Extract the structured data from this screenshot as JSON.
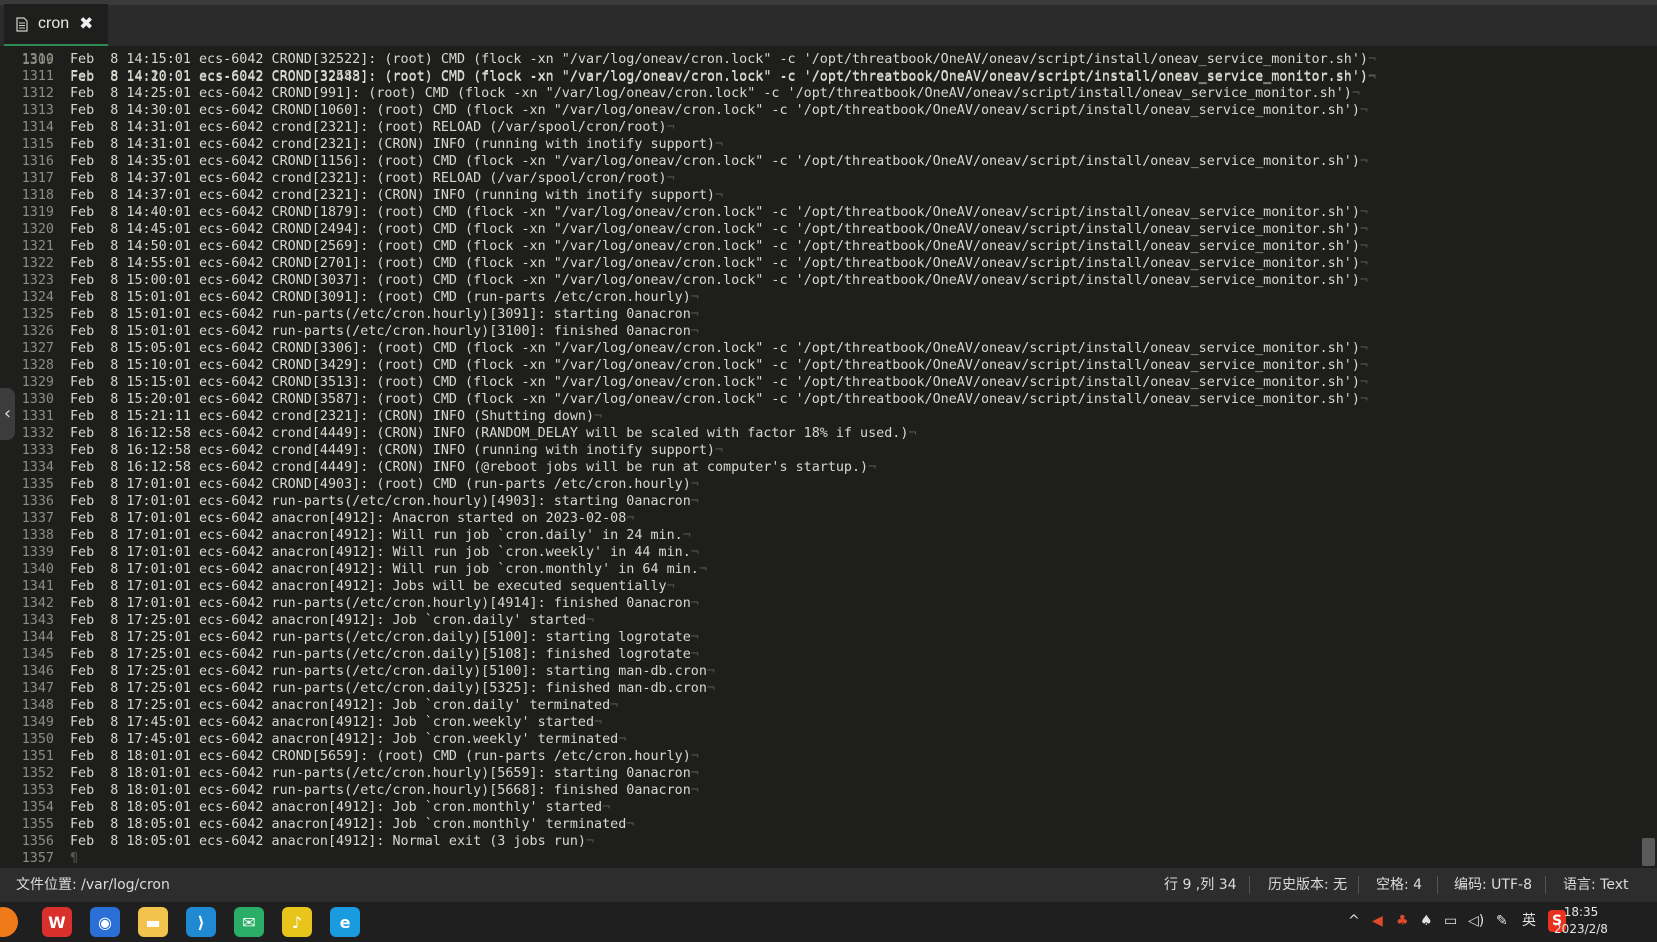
{
  "tab": {
    "name": "cron",
    "close_glyph": "✖"
  },
  "editor": {
    "partial_top_line": {
      "num": "1309",
      "text": "Feb  8 14:10:01 ecs-6042 CROND[32448]: (root) CMD (flock -xn \"/var/log/oneav/cron.lock\" -c '/opt/threatbook/OneAV/oneav/script/install/oneav_service_monitor.sh')"
    },
    "lines": [
      {
        "num": "1310",
        "text": "Feb  8 14:15:01 ecs-6042 CROND[32522]: (root) CMD (flock -xn \"/var/log/oneav/cron.lock\" -c '/opt/threatbook/OneAV/oneav/script/install/oneav_service_monitor.sh')"
      },
      {
        "num": "1311",
        "text": "Feb  8 14:20:01 ecs-6042 CROND[32583]: (root) CMD (flock -xn \"/var/log/oneav/cron.lock\" -c '/opt/threatbook/OneAV/oneav/script/install/oneav_service_monitor.sh')"
      },
      {
        "num": "1312",
        "text": "Feb  8 14:25:01 ecs-6042 CROND[991]: (root) CMD (flock -xn \"/var/log/oneav/cron.lock\" -c '/opt/threatbook/OneAV/oneav/script/install/oneav_service_monitor.sh')"
      },
      {
        "num": "1313",
        "text": "Feb  8 14:30:01 ecs-6042 CROND[1060]: (root) CMD (flock -xn \"/var/log/oneav/cron.lock\" -c '/opt/threatbook/OneAV/oneav/script/install/oneav_service_monitor.sh')"
      },
      {
        "num": "1314",
        "text": "Feb  8 14:31:01 ecs-6042 crond[2321]: (root) RELOAD (/var/spool/cron/root)"
      },
      {
        "num": "1315",
        "text": "Feb  8 14:31:01 ecs-6042 crond[2321]: (CRON) INFO (running with inotify support)"
      },
      {
        "num": "1316",
        "text": "Feb  8 14:35:01 ecs-6042 CROND[1156]: (root) CMD (flock -xn \"/var/log/oneav/cron.lock\" -c '/opt/threatbook/OneAV/oneav/script/install/oneav_service_monitor.sh')"
      },
      {
        "num": "1317",
        "text": "Feb  8 14:37:01 ecs-6042 crond[2321]: (root) RELOAD (/var/spool/cron/root)"
      },
      {
        "num": "1318",
        "text": "Feb  8 14:37:01 ecs-6042 crond[2321]: (CRON) INFO (running with inotify support)"
      },
      {
        "num": "1319",
        "text": "Feb  8 14:40:01 ecs-6042 CROND[1879]: (root) CMD (flock -xn \"/var/log/oneav/cron.lock\" -c '/opt/threatbook/OneAV/oneav/script/install/oneav_service_monitor.sh')"
      },
      {
        "num": "1320",
        "text": "Feb  8 14:45:01 ecs-6042 CROND[2494]: (root) CMD (flock -xn \"/var/log/oneav/cron.lock\" -c '/opt/threatbook/OneAV/oneav/script/install/oneav_service_monitor.sh')"
      },
      {
        "num": "1321",
        "text": "Feb  8 14:50:01 ecs-6042 CROND[2569]: (root) CMD (flock -xn \"/var/log/oneav/cron.lock\" -c '/opt/threatbook/OneAV/oneav/script/install/oneav_service_monitor.sh')"
      },
      {
        "num": "1322",
        "text": "Feb  8 14:55:01 ecs-6042 CROND[2701]: (root) CMD (flock -xn \"/var/log/oneav/cron.lock\" -c '/opt/threatbook/OneAV/oneav/script/install/oneav_service_monitor.sh')"
      },
      {
        "num": "1323",
        "text": "Feb  8 15:00:01 ecs-6042 CROND[3037]: (root) CMD (flock -xn \"/var/log/oneav/cron.lock\" -c '/opt/threatbook/OneAV/oneav/script/install/oneav_service_monitor.sh')"
      },
      {
        "num": "1324",
        "text": "Feb  8 15:01:01 ecs-6042 CROND[3091]: (root) CMD (run-parts /etc/cron.hourly)"
      },
      {
        "num": "1325",
        "text": "Feb  8 15:01:01 ecs-6042 run-parts(/etc/cron.hourly)[3091]: starting 0anacron"
      },
      {
        "num": "1326",
        "text": "Feb  8 15:01:01 ecs-6042 run-parts(/etc/cron.hourly)[3100]: finished 0anacron"
      },
      {
        "num": "1327",
        "text": "Feb  8 15:05:01 ecs-6042 CROND[3306]: (root) CMD (flock -xn \"/var/log/oneav/cron.lock\" -c '/opt/threatbook/OneAV/oneav/script/install/oneav_service_monitor.sh')"
      },
      {
        "num": "1328",
        "text": "Feb  8 15:10:01 ecs-6042 CROND[3429]: (root) CMD (flock -xn \"/var/log/oneav/cron.lock\" -c '/opt/threatbook/OneAV/oneav/script/install/oneav_service_monitor.sh')"
      },
      {
        "num": "1329",
        "text": "Feb  8 15:15:01 ecs-6042 CROND[3513]: (root) CMD (flock -xn \"/var/log/oneav/cron.lock\" -c '/opt/threatbook/OneAV/oneav/script/install/oneav_service_monitor.sh')"
      },
      {
        "num": "1330",
        "text": "Feb  8 15:20:01 ecs-6042 CROND[3587]: (root) CMD (flock -xn \"/var/log/oneav/cron.lock\" -c '/opt/threatbook/OneAV/oneav/script/install/oneav_service_monitor.sh')"
      },
      {
        "num": "1331",
        "text": "Feb  8 15:21:11 ecs-6042 crond[2321]: (CRON) INFO (Shutting down)"
      },
      {
        "num": "1332",
        "text": "Feb  8 16:12:58 ecs-6042 crond[4449]: (CRON) INFO (RANDOM_DELAY will be scaled with factor 18% if used.)"
      },
      {
        "num": "1333",
        "text": "Feb  8 16:12:58 ecs-6042 crond[4449]: (CRON) INFO (running with inotify support)"
      },
      {
        "num": "1334",
        "text": "Feb  8 16:12:58 ecs-6042 crond[4449]: (CRON) INFO (@reboot jobs will be run at computer's startup.)"
      },
      {
        "num": "1335",
        "text": "Feb  8 17:01:01 ecs-6042 CROND[4903]: (root) CMD (run-parts /etc/cron.hourly)"
      },
      {
        "num": "1336",
        "text": "Feb  8 17:01:01 ecs-6042 run-parts(/etc/cron.hourly)[4903]: starting 0anacron"
      },
      {
        "num": "1337",
        "text": "Feb  8 17:01:01 ecs-6042 anacron[4912]: Anacron started on 2023-02-08"
      },
      {
        "num": "1338",
        "text": "Feb  8 17:01:01 ecs-6042 anacron[4912]: Will run job `cron.daily' in 24 min."
      },
      {
        "num": "1339",
        "text": "Feb  8 17:01:01 ecs-6042 anacron[4912]: Will run job `cron.weekly' in 44 min."
      },
      {
        "num": "1340",
        "text": "Feb  8 17:01:01 ecs-6042 anacron[4912]: Will run job `cron.monthly' in 64 min."
      },
      {
        "num": "1341",
        "text": "Feb  8 17:01:01 ecs-6042 anacron[4912]: Jobs will be executed sequentially"
      },
      {
        "num": "1342",
        "text": "Feb  8 17:01:01 ecs-6042 run-parts(/etc/cron.hourly)[4914]: finished 0anacron"
      },
      {
        "num": "1343",
        "text": "Feb  8 17:25:01 ecs-6042 anacron[4912]: Job `cron.daily' started"
      },
      {
        "num": "1344",
        "text": "Feb  8 17:25:01 ecs-6042 run-parts(/etc/cron.daily)[5100]: starting logrotate"
      },
      {
        "num": "1345",
        "text": "Feb  8 17:25:01 ecs-6042 run-parts(/etc/cron.daily)[5108]: finished logrotate"
      },
      {
        "num": "1346",
        "text": "Feb  8 17:25:01 ecs-6042 run-parts(/etc/cron.daily)[5100]: starting man-db.cron"
      },
      {
        "num": "1347",
        "text": "Feb  8 17:25:01 ecs-6042 run-parts(/etc/cron.daily)[5325]: finished man-db.cron"
      },
      {
        "num": "1348",
        "text": "Feb  8 17:25:01 ecs-6042 anacron[4912]: Job `cron.daily' terminated"
      },
      {
        "num": "1349",
        "text": "Feb  8 17:45:01 ecs-6042 anacron[4912]: Job `cron.weekly' started"
      },
      {
        "num": "1350",
        "text": "Feb  8 17:45:01 ecs-6042 anacron[4912]: Job `cron.weekly' terminated"
      },
      {
        "num": "1351",
        "text": "Feb  8 18:01:01 ecs-6042 CROND[5659]: (root) CMD (run-parts /etc/cron.hourly)"
      },
      {
        "num": "1352",
        "text": "Feb  8 18:01:01 ecs-6042 run-parts(/etc/cron.hourly)[5659]: starting 0anacron"
      },
      {
        "num": "1353",
        "text": "Feb  8 18:01:01 ecs-6042 run-parts(/etc/cron.hourly)[5668]: finished 0anacron"
      },
      {
        "num": "1354",
        "text": "Feb  8 18:05:01 ecs-6042 anacron[4912]: Job `cron.monthly' started"
      },
      {
        "num": "1355",
        "text": "Feb  8 18:05:01 ecs-6042 anacron[4912]: Job `cron.monthly' terminated"
      },
      {
        "num": "1356",
        "text": "Feb  8 18:05:01 ecs-6042 anacron[4912]: Normal exit (3 jobs run)"
      },
      {
        "num": "1357",
        "text": ""
      }
    ],
    "eol_glyph": "¬",
    "final_eol_glyph": "¶"
  },
  "statusbar": {
    "file_location": "文件位置: /var/log/cron",
    "cursor_position": "行 9 ,列 34",
    "history_version": "历史版本: 无",
    "indent": "空格: 4",
    "encoding": "编码: UTF-8",
    "language": "语言: Text"
  },
  "taskbar": {
    "apps": [
      {
        "icon": "wps-office-icon",
        "glyph": "W",
        "color": "#d9302c"
      },
      {
        "icon": "chrome-browser-icon",
        "glyph": "◉",
        "color": "#2a6fd6"
      },
      {
        "icon": "file-explorer-icon",
        "glyph": "▬",
        "color": "#f1c24c"
      },
      {
        "icon": "vscode-icon",
        "glyph": "⟩",
        "color": "#1f8ad2"
      },
      {
        "icon": "wechat-icon",
        "glyph": "✉",
        "color": "#2aae67"
      },
      {
        "icon": "music-player-icon",
        "glyph": "♪",
        "color": "#e7c51a"
      },
      {
        "icon": "edge-browser-icon",
        "glyph": "e",
        "color": "#1a9be0"
      }
    ],
    "input_method": "英",
    "clock_time": "18:35",
    "clock_date": "2023/2/8"
  }
}
